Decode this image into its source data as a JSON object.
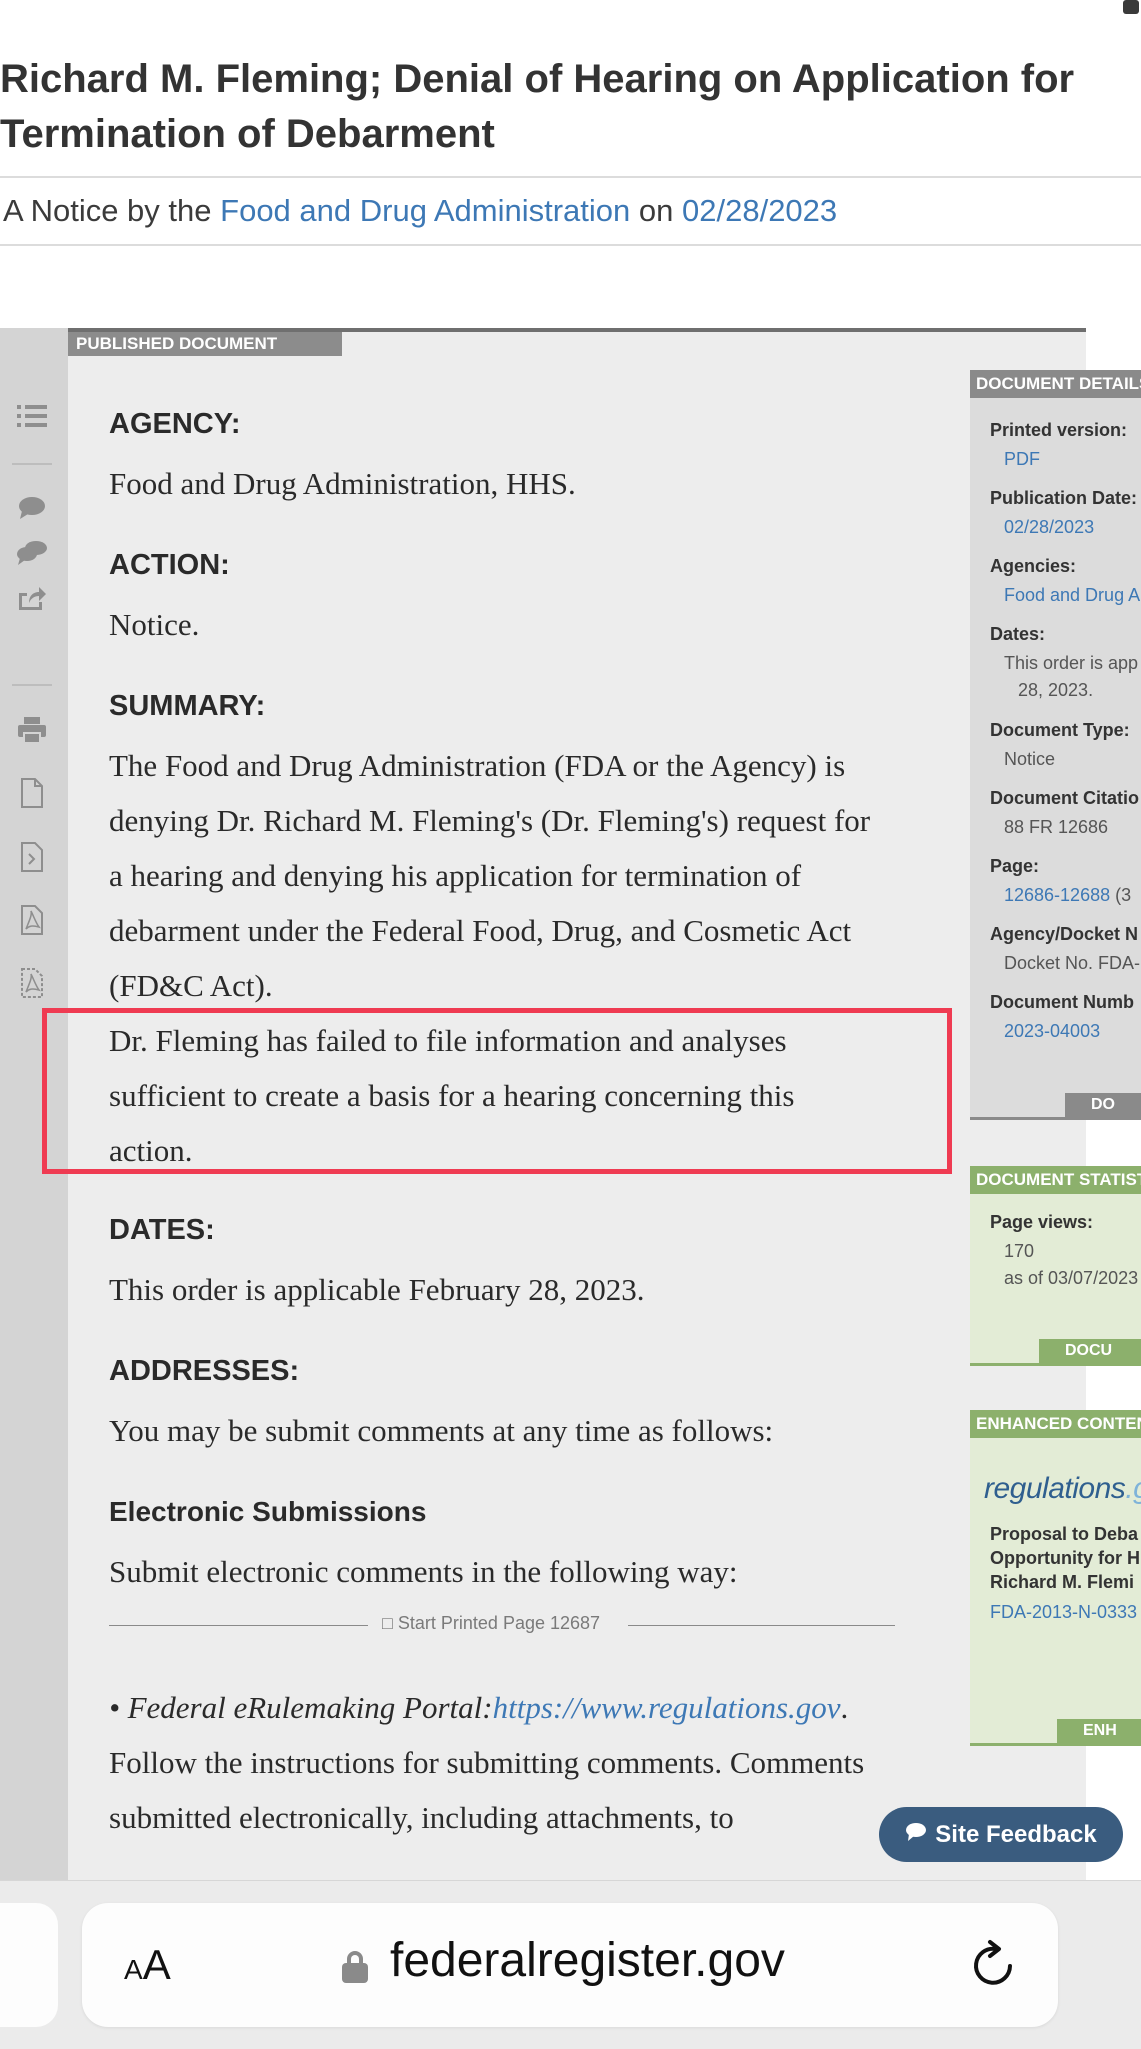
{
  "document": {
    "title": "Richard M. Fleming; Denial of Hearing on Application for Termination of Debarment",
    "byline_prefix": "A Notice by the",
    "agency_link": "Food and Drug Administration",
    "byline_on": "on",
    "date_link": "02/28/2023",
    "published_tag": "PUBLISHED DOCUMENT"
  },
  "sections": {
    "agency_heading": "AGENCY:",
    "agency_text": "Food and Drug Administration, HHS.",
    "action_heading": "ACTION:",
    "action_text": "Notice.",
    "summary_heading": "SUMMARY:",
    "summary_text": "The Food and Drug Administration (FDA or the Agency) is denying Dr. Richard M. Fleming's (Dr. Fleming's) request for a hearing and denying his application for termination of debarment under the Federal Food, Drug, and Cosmetic Act (FD&C Act).",
    "summary_highlight": "Dr. Fleming has failed to file information and analyses sufficient to create a basis for a hearing concerning this action.",
    "dates_heading": "DATES:",
    "dates_text": "This order is applicable February 28, 2023.",
    "addresses_heading": "ADDRESSES:",
    "addresses_text": "You may be submit comments at any time as follows:",
    "electronic_heading": "Electronic Submissions",
    "electronic_text": "Submit electronic comments in the following way:",
    "printed_page": "Start Printed Page 12687",
    "bullet_label": "• Federal eRulemaking Portal:",
    "bullet_link": "https://www.regulations.gov",
    "bullet_text": ". Follow the instructions for submitting comments. Comments submitted electronically, including attachments, to"
  },
  "sidebar": {
    "details_header": "DOCUMENT DETAILS",
    "printed_version_label": "Printed version:",
    "printed_version_value": "PDF",
    "publication_date_label": "Publication Date:",
    "publication_date_value": "02/28/2023",
    "agencies_label": "Agencies:",
    "agencies_value": "Food and Drug A",
    "dates_label": "Dates:",
    "dates_value_1": "This order is app",
    "dates_value_2": "28, 2023.",
    "doctype_label": "Document Type:",
    "doctype_value": "Notice",
    "citation_label": "Document Citatio",
    "citation_value": "88 FR 12686",
    "page_label": "Page:",
    "page_value": "12686-12688",
    "page_extra": "(3",
    "docket_label": "Agency/Docket N",
    "docket_value": "Docket No. FDA-",
    "docnum_label": "Document Numb",
    "docnum_value": "2023-04003",
    "details_footer": "DO",
    "stats_header": "DOCUMENT STATISTICS",
    "pageviews_label": "Page views:",
    "pageviews_value": "170",
    "pageviews_asof": "as of 03/07/2023",
    "stats_footer": "DOCU",
    "enhanced_header": "ENHANCED CONTENT",
    "reg_logo_main": "regulations",
    "reg_logo_suffix": ".g",
    "enhanced_title_1": "Proposal to Deba",
    "enhanced_title_2": "Opportunity for H",
    "enhanced_title_3": "Richard M. Flemi",
    "enhanced_link": "FDA-2013-N-0333",
    "enhanced_footer": "ENH"
  },
  "feedback_label": "Site Feedback",
  "browser": {
    "aa_label": "AA",
    "domain": "federalregister.gov"
  }
}
